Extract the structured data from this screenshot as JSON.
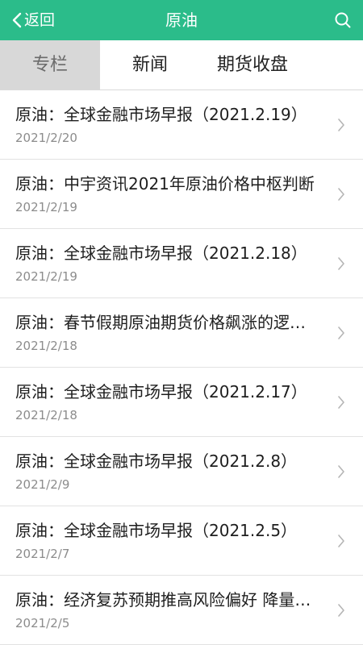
{
  "header": {
    "back_label": "返回",
    "title": "原油",
    "accent_color": "#2bbc8a",
    "icons": {
      "back": "chevron-left-icon",
      "search": "search-icon"
    }
  },
  "tabs": [
    {
      "label": "专栏",
      "active": true
    },
    {
      "label": "新闻",
      "active": false
    },
    {
      "label": "期货收盘",
      "active": false
    }
  ],
  "articles": [
    {
      "title": "原油：全球金融市场早报（2021.2.19）",
      "date": "2021/2/20"
    },
    {
      "title": "原油：中宇资讯2021年原油价格中枢判断",
      "date": "2021/2/19"
    },
    {
      "title": "原油：全球金融市场早报（2021.2.18）",
      "date": "2021/2/19"
    },
    {
      "title": "原油：春节假期原油期货价格飙涨的逻…",
      "date": "2021/2/18"
    },
    {
      "title": "原油：全球金融市场早报（2021.2.17）",
      "date": "2021/2/18"
    },
    {
      "title": "原油：全球金融市场早报（2021.2.8）",
      "date": "2021/2/9"
    },
    {
      "title": "原油：全球金融市场早报（2021.2.5）",
      "date": "2021/2/7"
    },
    {
      "title": "原油：经济复苏预期推高风险偏好 降量…",
      "date": "2021/2/5"
    }
  ]
}
